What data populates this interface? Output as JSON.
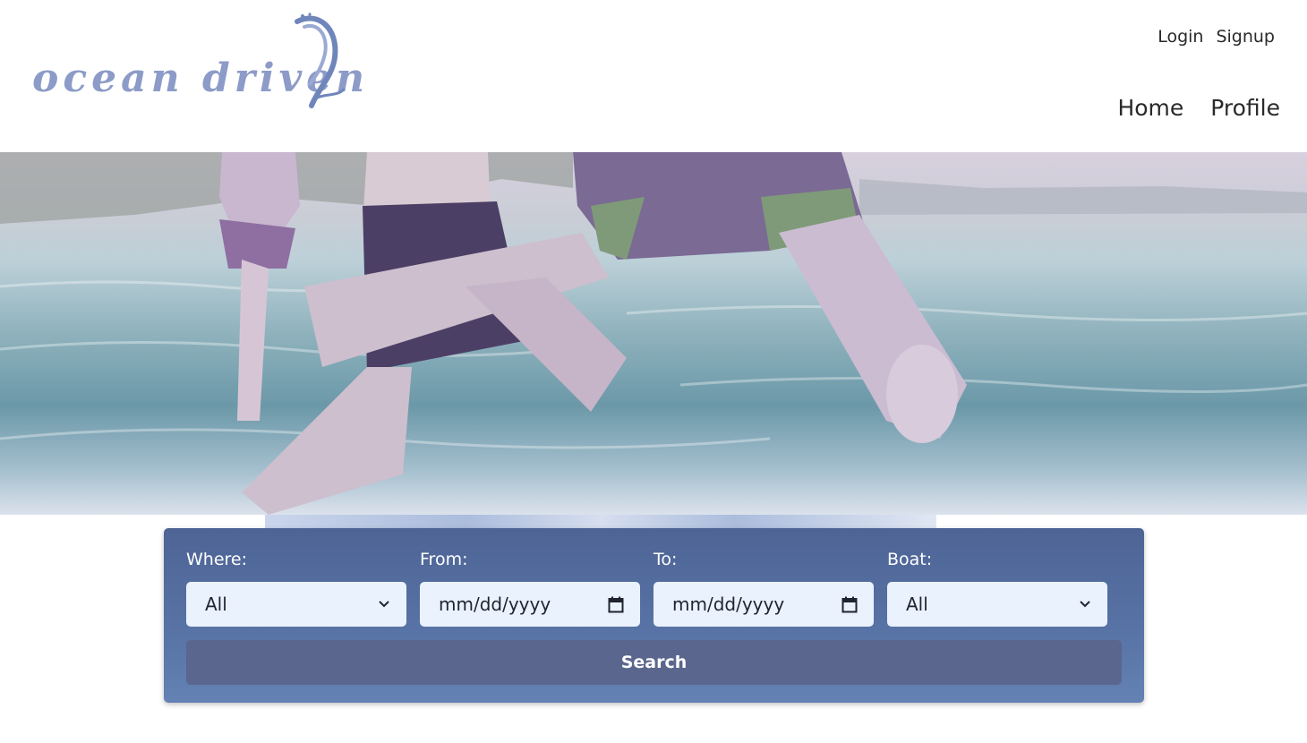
{
  "brand": {
    "logo_text": "ocean driven"
  },
  "top_links": [
    {
      "label": "Login"
    },
    {
      "label": "Signup"
    }
  ],
  "main_nav": [
    {
      "label": "Home"
    },
    {
      "label": "Profile"
    }
  ],
  "hero": {
    "image": "people-jumping-into-ocean-photo"
  },
  "search": {
    "where": {
      "label": "Where:",
      "value": "All",
      "icon": "chevron-down-icon"
    },
    "from": {
      "label": "From:",
      "value": "mm/dd/yyyy",
      "icon": "calendar-icon"
    },
    "to": {
      "label": "To:",
      "value": "mm/dd/yyyy",
      "icon": "calendar-icon"
    },
    "boat": {
      "label": "Boat:",
      "value": "All",
      "icon": "chevron-down-icon"
    },
    "button_label": "Search"
  },
  "colors": {
    "panel": "#4e6495",
    "input_bg": "#eaf2fd",
    "button": "#5a668d",
    "logo": "#8c9bc7"
  }
}
